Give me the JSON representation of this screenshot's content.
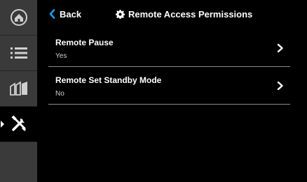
{
  "header": {
    "back_label": "Back",
    "title": "Remote Access Permissions",
    "back_icon": "chevron-left-icon",
    "title_icon": "gear-icon"
  },
  "sidebar": {
    "items": [
      {
        "icon": "home-icon",
        "active": false
      },
      {
        "icon": "list-icon",
        "active": false
      },
      {
        "icon": "zones-icon",
        "active": false
      },
      {
        "icon": "tools-icon",
        "active": true
      },
      {
        "icon": "empty",
        "active": false
      }
    ]
  },
  "settings": [
    {
      "label": "Remote Pause",
      "value": "Yes"
    },
    {
      "label": "Remote Set Standby Mode",
      "value": "No"
    }
  ],
  "colors": {
    "accent": "#1f9bf0",
    "sidebar_bg": "#3a3a3a",
    "background": "#000000",
    "divider": "#8a8a8a"
  }
}
